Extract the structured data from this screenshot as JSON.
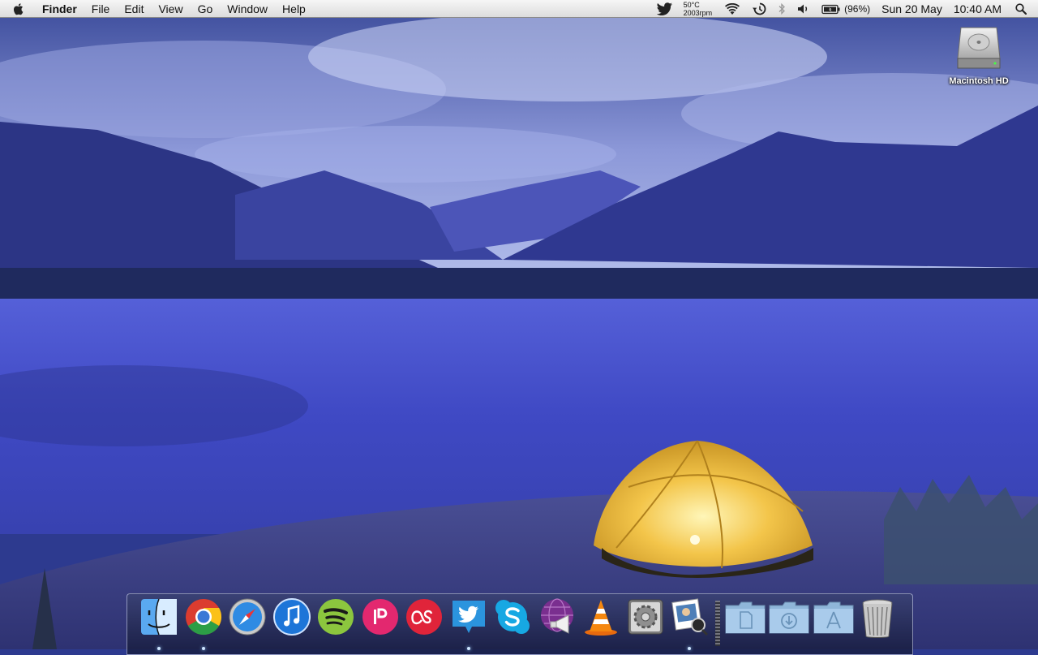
{
  "menubar": {
    "app_name": "Finder",
    "menus": [
      "File",
      "Edit",
      "View",
      "Go",
      "Window",
      "Help"
    ],
    "status": {
      "temperature": "50°C",
      "fan_speed": "2003rpm",
      "battery_percent": "(96%)",
      "date": "Sun 20 May",
      "time": "10:40 AM"
    },
    "status_icons": [
      "twitter-icon",
      "wifi-icon",
      "time-machine-icon",
      "bluetooth-icon",
      "volume-icon",
      "battery-icon",
      "spotlight-icon"
    ]
  },
  "desktop": {
    "icons": [
      {
        "label": "Macintosh HD",
        "icon": "hard-drive-icon"
      }
    ]
  },
  "dock": {
    "apps": [
      {
        "name": "Finder",
        "icon": "finder-icon",
        "running": true
      },
      {
        "name": "Google Chrome",
        "icon": "chrome-icon",
        "running": true
      },
      {
        "name": "Safari",
        "icon": "safari-icon",
        "running": false
      },
      {
        "name": "iTunes",
        "icon": "itunes-icon",
        "running": false
      },
      {
        "name": "Spotify",
        "icon": "spotify-icon",
        "running": false
      },
      {
        "name": "Instacast",
        "icon": "podcast-icon",
        "running": false
      },
      {
        "name": "Last.fm",
        "icon": "lastfm-icon",
        "running": false
      },
      {
        "name": "Twitter",
        "icon": "twitter-icon",
        "running": true
      },
      {
        "name": "Skype",
        "icon": "skype-icon",
        "running": false
      },
      {
        "name": "Adium",
        "icon": "megaphone-globe-icon",
        "running": false
      },
      {
        "name": "VLC",
        "icon": "vlc-icon",
        "running": false
      },
      {
        "name": "System Preferences",
        "icon": "system-preferences-icon",
        "running": false
      },
      {
        "name": "Preview",
        "icon": "preview-icon",
        "running": true
      }
    ],
    "stacks": [
      {
        "name": "Documents",
        "icon": "documents-folder-icon"
      },
      {
        "name": "Downloads",
        "icon": "downloads-folder-icon"
      },
      {
        "name": "Applications",
        "icon": "applications-folder-icon"
      },
      {
        "name": "Trash",
        "icon": "trash-icon"
      }
    ]
  }
}
